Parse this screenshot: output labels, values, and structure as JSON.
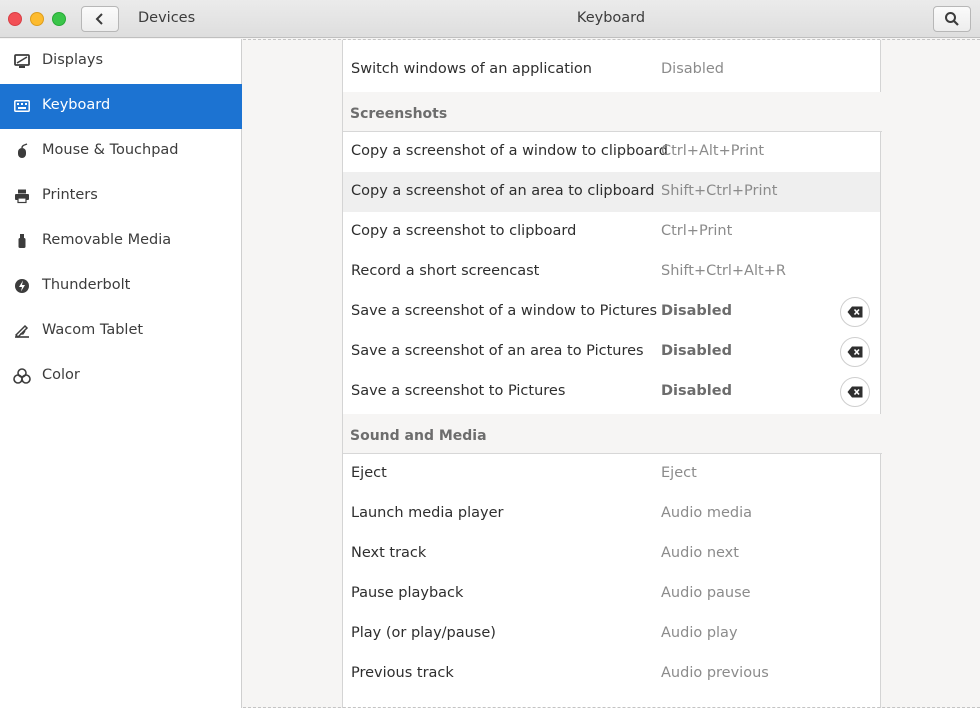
{
  "header": {
    "section_title": "Devices",
    "page_title": "Keyboard"
  },
  "sidebar": {
    "items": [
      {
        "label": "Displays",
        "icon": "display-icon",
        "selected": false
      },
      {
        "label": "Keyboard",
        "icon": "keyboard-icon",
        "selected": true
      },
      {
        "label": "Mouse & Touchpad",
        "icon": "mouse-icon",
        "selected": false
      },
      {
        "label": "Printers",
        "icon": "printer-icon",
        "selected": false
      },
      {
        "label": "Removable Media",
        "icon": "usb-drive-icon",
        "selected": false
      },
      {
        "label": "Thunderbolt",
        "icon": "thunderbolt-icon",
        "selected": false
      },
      {
        "label": "Wacom Tablet",
        "icon": "tablet-icon",
        "selected": false
      },
      {
        "label": "Color",
        "icon": "color-icon",
        "selected": false
      }
    ]
  },
  "shortcuts": {
    "top_row": {
      "name": "Switch windows of an application",
      "accel": "Disabled"
    },
    "screenshots": {
      "title": "Screenshots",
      "rows": [
        {
          "name": "Copy a screenshot of a window to clipboard",
          "accel": "Ctrl+Alt+Print"
        },
        {
          "name": "Copy a screenshot of an area to clipboard",
          "accel": "Shift+Ctrl+Print"
        },
        {
          "name": "Copy a screenshot to clipboard",
          "accel": "Ctrl+Print"
        },
        {
          "name": "Record a short screencast",
          "accel": "Shift+Ctrl+Alt+R"
        },
        {
          "name": "Save a screenshot of a window to Pictures",
          "accel": "Disabled"
        },
        {
          "name": "Save a screenshot of an area to Pictures",
          "accel": "Disabled"
        },
        {
          "name": "Save a screenshot to Pictures",
          "accel": "Disabled"
        }
      ]
    },
    "sound_media": {
      "title": "Sound and Media",
      "rows": [
        {
          "name": "Eject",
          "accel": "Eject"
        },
        {
          "name": "Launch media player",
          "accel": "Audio media"
        },
        {
          "name": "Next track",
          "accel": "Audio next"
        },
        {
          "name": "Pause playback",
          "accel": "Audio pause"
        },
        {
          "name": "Play (or play/pause)",
          "accel": "Audio play"
        },
        {
          "name": "Previous track",
          "accel": "Audio previous"
        }
      ]
    }
  },
  "colors": {
    "accent": "#1c73d2",
    "close": "#f25056",
    "minimize": "#fdbb2e",
    "maximize": "#3ac549"
  }
}
